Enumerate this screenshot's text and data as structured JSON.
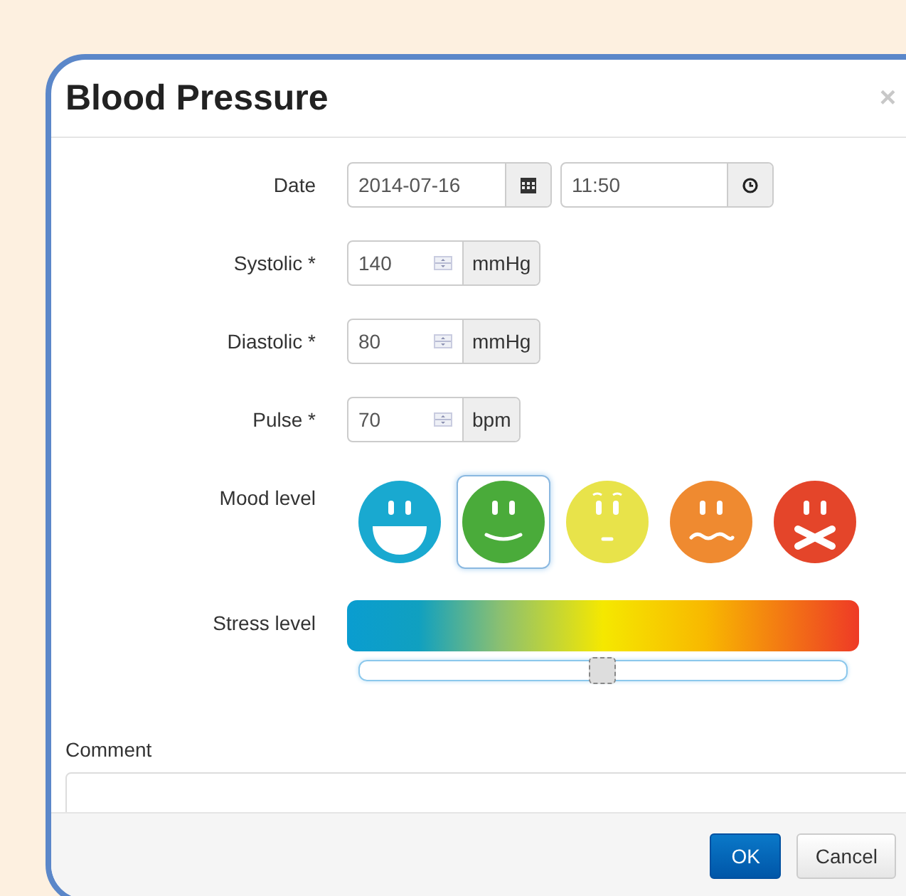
{
  "dialog": {
    "title": "Blood Pressure",
    "close": "×"
  },
  "date": {
    "label": "Date",
    "value": "2014-07-16"
  },
  "time": {
    "value": "11:50"
  },
  "measurements": [
    {
      "label": "Systolic *",
      "value": "140",
      "unit": "mmHg"
    },
    {
      "label": "Diastolic *",
      "value": "80",
      "unit": "mmHg"
    },
    {
      "label": "Pulse *",
      "value": "70",
      "unit": "bpm"
    }
  ],
  "mood": {
    "label": "Mood level",
    "options": [
      {
        "kind": "grin",
        "color": "#19a9d0",
        "selected": false
      },
      {
        "kind": "smile",
        "color": "#4aab3a",
        "selected": true
      },
      {
        "kind": "neutral",
        "color": "#e8e34a",
        "selected": false
      },
      {
        "kind": "frown",
        "color": "#ef8a30",
        "selected": false
      },
      {
        "kind": "cross",
        "color": "#e4452a",
        "selected": false
      }
    ]
  },
  "stress": {
    "label": "Stress level",
    "level": 0.5
  },
  "comment": {
    "label": "Comment"
  },
  "buttons": [
    {
      "label": "OK",
      "kind": "primary"
    },
    {
      "label": "Cancel",
      "kind": "default"
    }
  ]
}
